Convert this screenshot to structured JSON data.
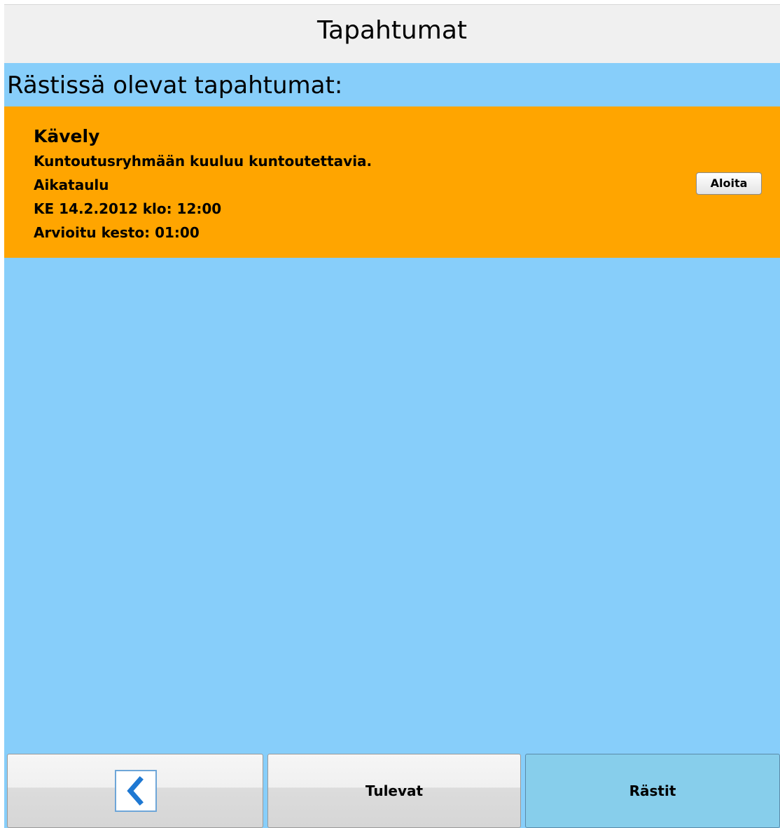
{
  "header": {
    "title": "Tapahtumat"
  },
  "section": {
    "heading": "Rästissä olevat tapahtumat:"
  },
  "event": {
    "title": "Kävely",
    "description": "Kuntoutusryhmään kuuluu kuntoutettavia.",
    "schedule_label": "Aikataulu",
    "datetime": "KE 14.2.2012 klo: 12:00",
    "duration": "Arvioitu kesto: 01:00",
    "start_label": "Aloita"
  },
  "footer": {
    "back_icon": "chevron-left-icon",
    "upcoming_label": "Tulevat",
    "overdue_label": "Rästit"
  },
  "colors": {
    "background": "#87cefa",
    "event_card": "#ffa500",
    "active_tab": "#87ceeb",
    "back_icon": "#1e78d2"
  }
}
